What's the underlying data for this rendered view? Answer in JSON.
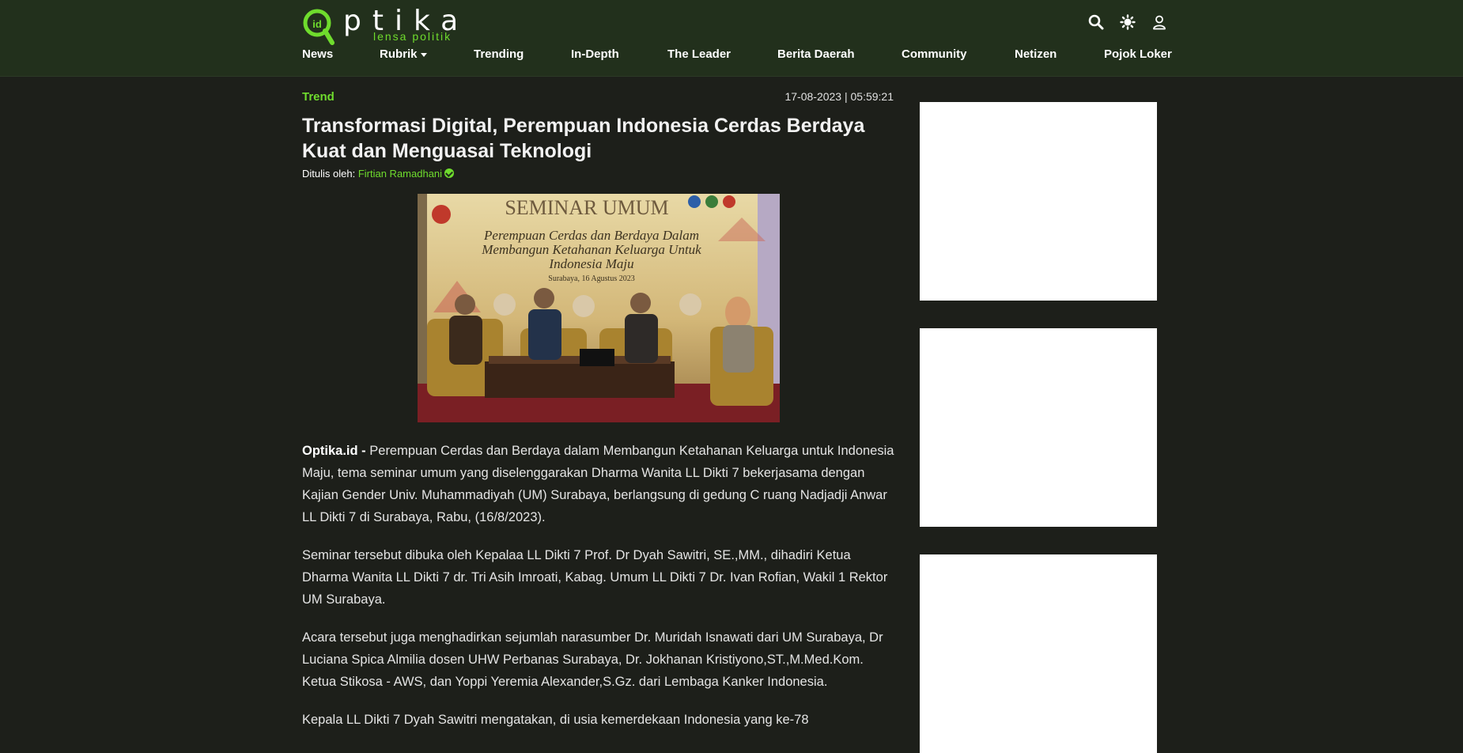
{
  "brand": {
    "name": "ptika",
    "tagline": "lensa politik",
    "logo_mark": "id",
    "accent": "#6fdc2d",
    "header_bg": "#22301c",
    "page_bg": "#1d1f1a"
  },
  "header_icons": [
    "search-icon",
    "theme-toggle-icon",
    "user-icon"
  ],
  "nav": {
    "items": [
      "News",
      "Rubrik",
      "Trending",
      "In-Depth",
      "The Leader",
      "Berita Daerah",
      "Community",
      "Netizen",
      "Pojok Loker"
    ]
  },
  "article": {
    "category": "Trend",
    "datetime": "17-08-2023 | 05:59:21",
    "title": "Transformasi Digital, Perempuan Indonesia Cerdas Berdaya Kuat dan Menguasai Teknologi",
    "byline_label": "Ditulis oleh:",
    "author": "Firtian Ramadhani",
    "image": {
      "heading": "SEMINAR UMUM",
      "subtitle_1": "Perempuan Cerdas dan Berdaya Dalam",
      "subtitle_2": "Membangun Ketahanan Keluarga Untuk",
      "subtitle_3": "Indonesia Maju",
      "place_date": "Surabaya, 16 Agustus 2023"
    },
    "lead_source": "Optika.id -",
    "paragraphs": [
      " Perempuan Cerdas dan Berdaya dalam Membangun Ketahanan Keluarga untuk Indonesia Maju, tema seminar umum yang diselenggarakan Dharma Wanita LL Dikti 7 bekerjasama dengan Kajian Gender Univ. Muhammadiyah (UM) Surabaya, berlangsung di gedung C ruang Nadjadji Anwar LL Dikti 7 di Surabaya, Rabu, (16/8/2023).",
      "Seminar tersebut dibuka oleh Kepalaa LL Dikti 7 Prof. Dr Dyah Sawitri, SE.,MM., dihadiri Ketua Dharma Wanita LL Dikti 7 dr. Tri Asih Imroati, Kabag. Umum LL Dikti 7 Dr. Ivan Rofian, Wakil 1 Rektor UM Surabaya.",
      "Acara tersebut juga menghadirkan sejumlah narasumber Dr. Muridah Isnawati dari UM Surabaya, Dr Luciana Spica Almilia dosen UHW Perbanas Surabaya, Dr. Jokhanan Kristiyono,ST.,M.Med.Kom. Ketua Stikosa - AWS, dan Yoppi Yeremia Alexander,S.Gz. dari Lembaga Kanker Indonesia.",
      "Kepala LL Dikti 7 Dyah Sawitri mengatakan, di usia kemerdekaan Indonesia yang ke-78"
    ]
  }
}
